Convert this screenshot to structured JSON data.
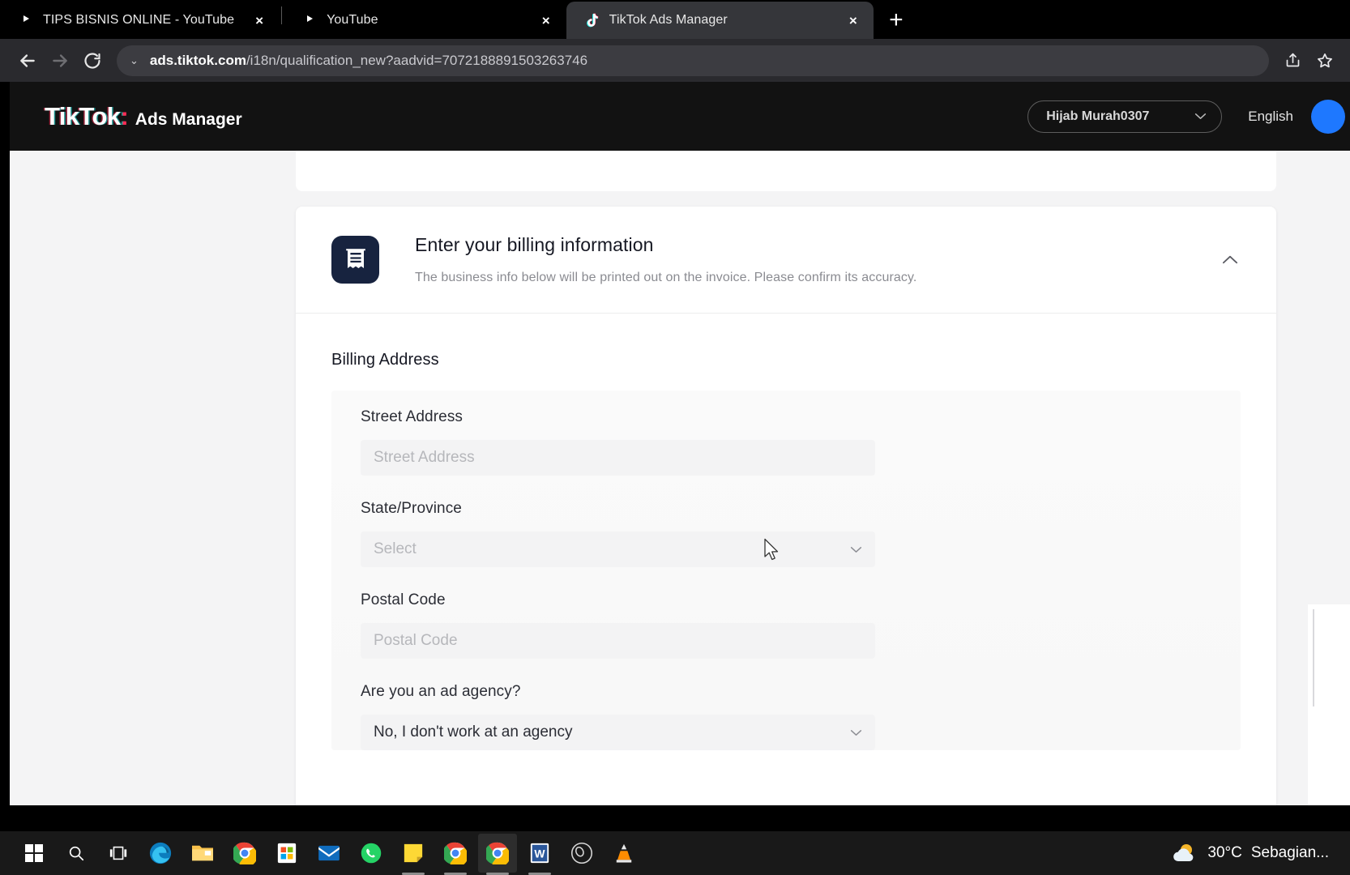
{
  "browser": {
    "tabs": [
      {
        "title": "TIPS BISNIS ONLINE - YouTube",
        "favicon": "youtube-icon",
        "active": false,
        "close_label": "×"
      },
      {
        "title": "YouTube",
        "favicon": "youtube-icon",
        "active": false,
        "close_label": "×"
      },
      {
        "title": "TikTok Ads Manager",
        "favicon": "tiktok-icon",
        "active": true,
        "close_label": "×"
      }
    ],
    "new_tab_label": "+",
    "back_label": "←",
    "forward_label": "→",
    "reload_label": "⟳",
    "omnibox": {
      "chevron": "⌄",
      "url_domain": "ads.tiktok.com",
      "url_path": "/i18n/qualification_new?aadvid=7072188891503263746"
    },
    "share_icon": "share-icon",
    "bookmark_icon": "star-icon"
  },
  "app_header": {
    "brand": "TikTok",
    "brand_colon": ":",
    "brand_sub": "Ads Manager",
    "account": {
      "name": "Hijab Murah0307",
      "chevron": "⌄"
    },
    "language": "English",
    "avatar": "user-avatar"
  },
  "billing_section": {
    "icon": "invoice-icon",
    "title": "Enter your billing information",
    "subtitle": "The business info below will be printed out on the invoice. Please confirm its accuracy.",
    "collapse_icon": "chevron-up-icon"
  },
  "form": {
    "section_title": "Billing Address",
    "fields": [
      {
        "label": "Street Address",
        "type": "text",
        "value": "",
        "placeholder": "Street Address"
      },
      {
        "label": "State/Province",
        "type": "select",
        "value": "",
        "placeholder": "Select"
      },
      {
        "label": "Postal Code",
        "type": "text",
        "value": "",
        "placeholder": "Postal Code"
      },
      {
        "label": "Are you an ad agency?",
        "type": "select",
        "value": "No, I don't work at an agency",
        "placeholder": ""
      }
    ]
  },
  "taskbar": {
    "items": [
      {
        "name": "start-button",
        "icon": "windows-logo-icon"
      },
      {
        "name": "search-button",
        "icon": "search-icon"
      },
      {
        "name": "task-view-button",
        "icon": "task-view-icon"
      },
      {
        "name": "edge-button",
        "icon": "edge-icon"
      },
      {
        "name": "file-explorer-button",
        "icon": "folder-icon"
      },
      {
        "name": "chrome-button",
        "icon": "chrome-icon"
      },
      {
        "name": "store-button",
        "icon": "microsoft-store-icon"
      },
      {
        "name": "mail-button",
        "icon": "mail-icon"
      },
      {
        "name": "whatsapp-button",
        "icon": "whatsapp-icon"
      },
      {
        "name": "sticky-notes-button",
        "icon": "sticky-note-icon"
      },
      {
        "name": "chrome-window-button",
        "icon": "chrome-icon"
      },
      {
        "name": "chrome-active-button",
        "icon": "chrome-icon"
      },
      {
        "name": "word-button",
        "icon": "word-icon"
      },
      {
        "name": "obs-button",
        "icon": "obs-icon"
      },
      {
        "name": "vlc-button",
        "icon": "vlc-icon"
      }
    ],
    "weather": {
      "icon": "partly-cloudy-icon",
      "temperature": "30°C",
      "condition": "Sebagian..."
    }
  },
  "colors": {
    "tiktok_red": "#fe2c55",
    "tiktok_cyan": "#25f4ee",
    "icon_navy": "#17233f",
    "page_bg": "#f4f4f5"
  }
}
